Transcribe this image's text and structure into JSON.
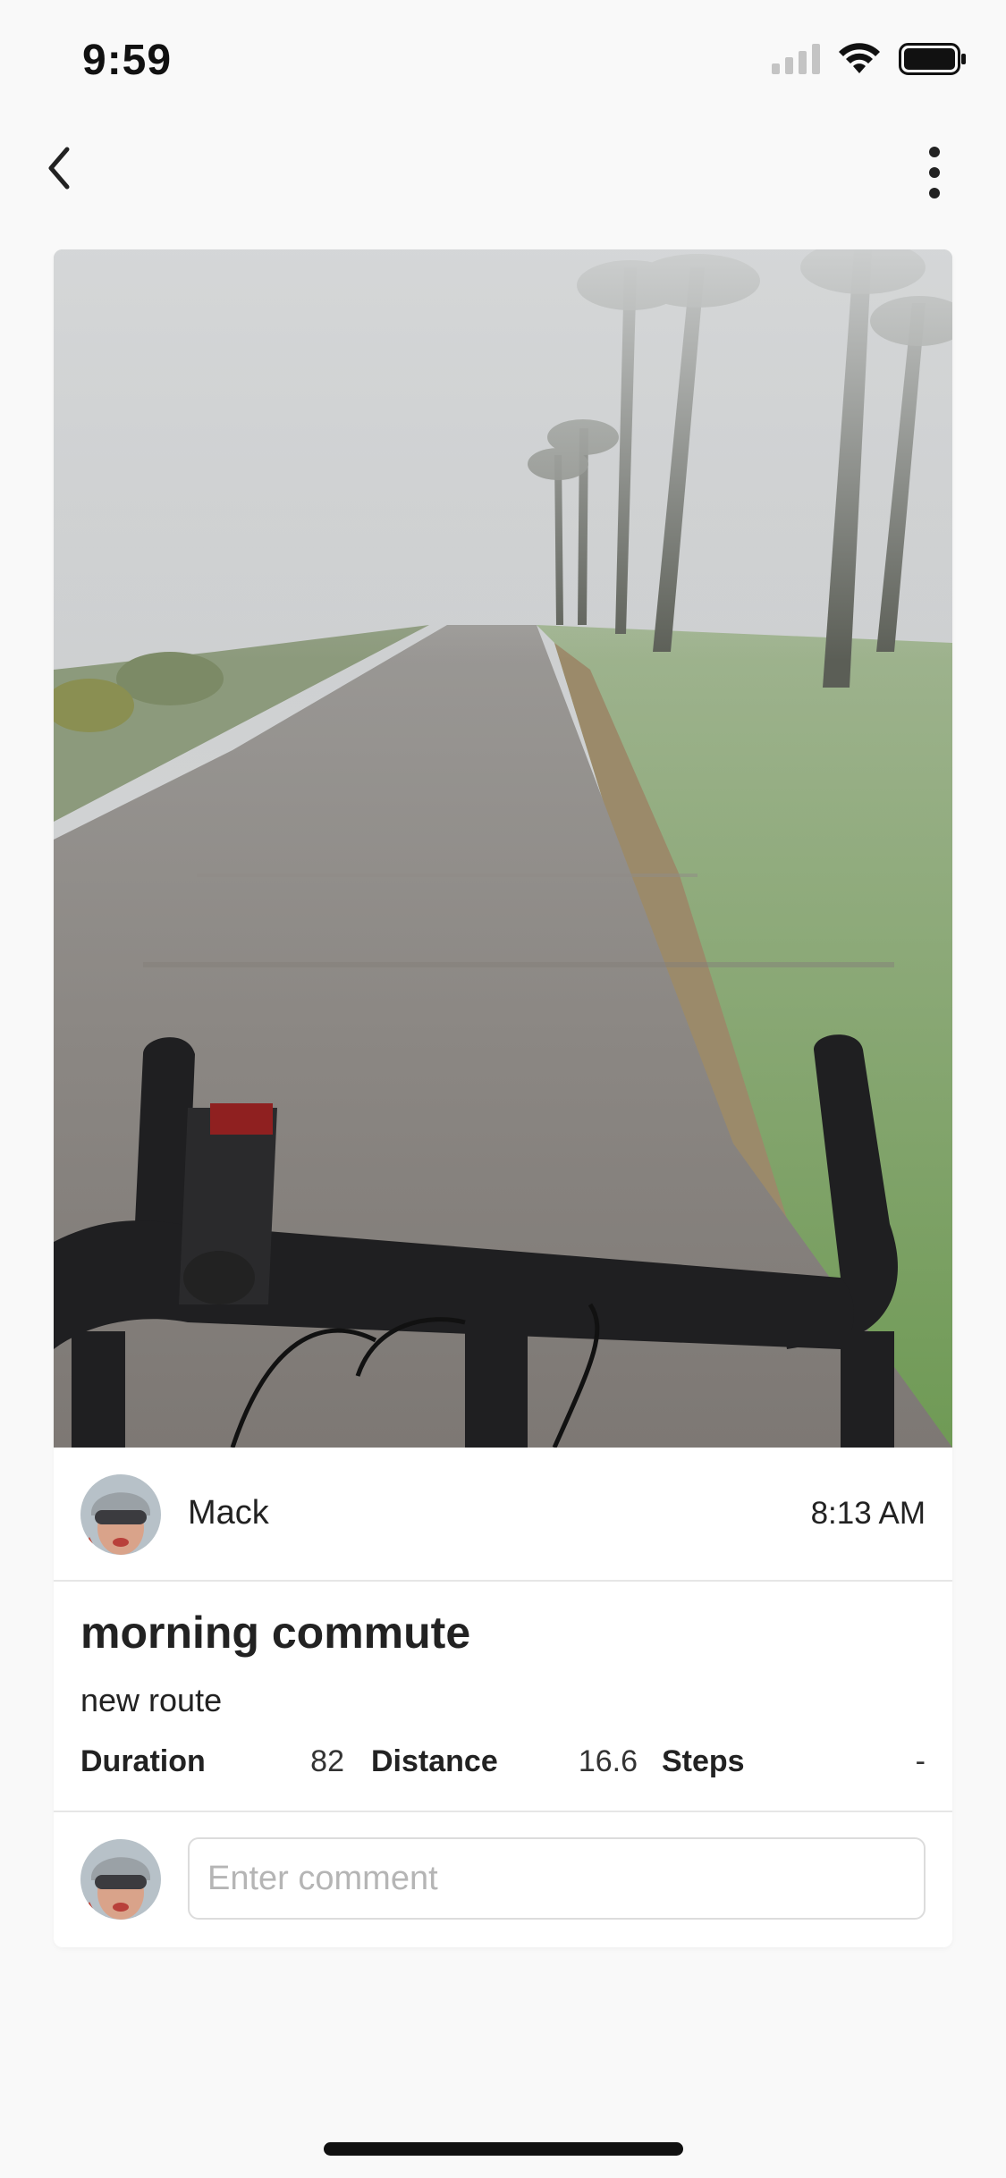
{
  "status_bar": {
    "time": "9:59",
    "icons": [
      "cellular-signal-icon",
      "wifi-icon",
      "battery-icon"
    ]
  },
  "nav": {
    "back_icon": "chevron-left-icon",
    "more_icon": "more-vertical-icon"
  },
  "post": {
    "author": {
      "name": "Mack",
      "avatar": "avatar-photo"
    },
    "time": "8:13 AM",
    "title": "morning commute",
    "subtitle": "new route",
    "stats": [
      {
        "label": "Duration",
        "value": "82"
      },
      {
        "label": "Distance",
        "value": "16.6"
      },
      {
        "label": "Steps",
        "value": "-"
      }
    ]
  },
  "comment": {
    "placeholder": "Enter comment"
  },
  "colors": {
    "background": "#f9f9f9",
    "card": "#ffffff",
    "divider": "#e6e6e6",
    "text": "#222222",
    "placeholder": "#b5b5b5"
  }
}
